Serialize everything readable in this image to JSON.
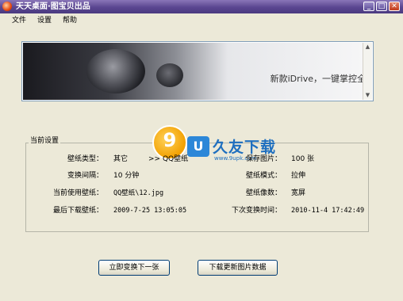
{
  "window": {
    "title": "天天桌面·图宝贝出品",
    "controls": {
      "minimize": "_",
      "maximize": "□",
      "close": "✕"
    }
  },
  "menu": [
    "文件",
    "设置",
    "帮助"
  ],
  "banner": {
    "text": "新款iDrive，一键掌控全"
  },
  "settings": {
    "group_title": "当前设置",
    "wallpaper_type_label": "壁纸类型：",
    "wallpaper_type_value": "其它",
    "wallpaper_type_link": ">> QQ壁纸",
    "saved_images_label": "保存图片：",
    "saved_images_value": "100 张",
    "interval_label": "变换间隔：",
    "interval_value": "10 分钟",
    "mode_label": "壁纸模式：",
    "mode_value": "拉伸",
    "current_label": "当前使用壁纸：",
    "current_value": "QQ壁纸\\12.jpg",
    "ratio_label": "壁纸像数：",
    "ratio_value": "宽屏",
    "last_download_label": "最后下载壁纸：",
    "last_download_value": "2009-7-25 13:05:05",
    "next_change_label": "下次变换时间：",
    "next_change_value": "2010-11-4 17:42:49"
  },
  "buttons": {
    "change_now": "立即变换下一张",
    "download": "下载更新图片数据"
  },
  "watermark": {
    "logo_char": "9",
    "u_char": "U",
    "title": "久友下载",
    "url": "www.9upk.com"
  },
  "colors": {
    "title_bar": "#5a4690",
    "window_bg": "#ece9d8",
    "watermark_blue": "#1f6fbf",
    "watermark_orange": "#f2a000"
  }
}
